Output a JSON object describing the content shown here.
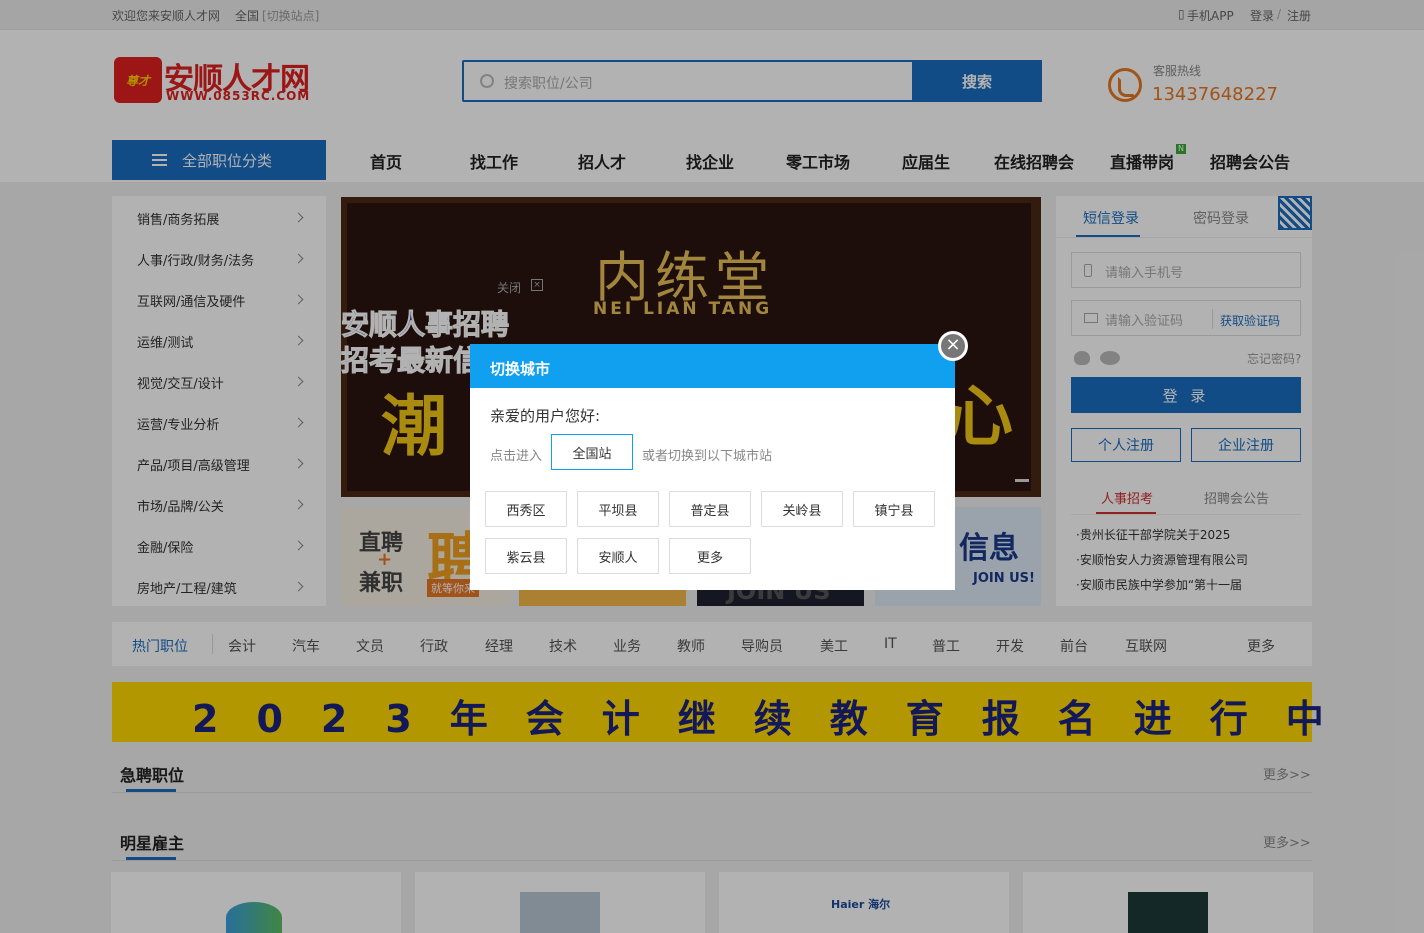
{
  "topbar": {
    "welcome": "欢迎您来安顺人才网",
    "region": "全国",
    "switch_site": "[切换站点]",
    "mobile_app": "手机APP",
    "login": "登录",
    "sep": "/",
    "register": "注册"
  },
  "header": {
    "logo_mark": "尊才",
    "logo_name": "安顺人才网",
    "logo_url": "WWW.0853RC.COM",
    "search_placeholder": "搜索职位/公司",
    "search_button": "搜索",
    "hotline_label": "客服热线",
    "hotline_number": "13437648227"
  },
  "nav": {
    "all_categories": "全部职位分类",
    "items": [
      "首页",
      "找工作",
      "招人才",
      "找企业",
      "零工市场",
      "应届生",
      "在线招聘会",
      "直播带岗",
      "招聘会公告"
    ],
    "badge": "N"
  },
  "sidebar": {
    "items": [
      "销售/商务拓展",
      "人事/行政/财务/法务",
      "互联网/通信及硬件",
      "运维/测试",
      "视觉/交互/设计",
      "运营/专业分析",
      "产品/项目/高级管理",
      "市场/品牌/公关",
      "金融/保险",
      "房地产/工程/建筑"
    ]
  },
  "banner": {
    "brand_cn": "内练堂",
    "brand_en": "NEI LIAN TANG",
    "close_label": "关闭",
    "overlay_line1": "安顺人事招聘",
    "overlay_line2": "招考最新信",
    "big_char_left": "潮",
    "big_char_right": "心"
  },
  "small_ads": {
    "ad1_line1": "直聘",
    "ad1_plus": "+",
    "ad1_line2": "兼职",
    "ad1_char": "聘",
    "ad1_sub": "就等你来",
    "ad4_title": "信息",
    "ad4_sub": "JOIN US!",
    "ad3_text": "JOIN US"
  },
  "login": {
    "tab_sms": "短信登录",
    "tab_password": "密码登录",
    "phone_placeholder": "请输入手机号",
    "code_placeholder": "请输入验证码",
    "get_code": "获取验证码",
    "forgot": "忘记密码?",
    "login_button": "登 录",
    "personal_register": "个人注册",
    "company_register": "企业注册",
    "news_tab1": "人事招考",
    "news_tab2": "招聘会公告",
    "news": [
      "·贵州长征干部学院关于2025",
      "·安顺怡安人力资源管理有限公司",
      "·安顺市民族中学参加“第十一届"
    ]
  },
  "hot_jobs": {
    "title": "热门职位",
    "items": [
      "会计",
      "汽车",
      "文员",
      "行政",
      "经理",
      "技术",
      "业务",
      "教师",
      "导购员",
      "美工",
      "IT",
      "普工",
      "开发",
      "前台",
      "互联网"
    ],
    "more": "更多"
  },
  "promo": {
    "text": "2023年会计继续教育报名进行中"
  },
  "sections": {
    "urgent": "急聘职位",
    "star": "明星雇主",
    "more": "更多>>"
  },
  "employers": {
    "haier": "Haier 海尔"
  },
  "modal": {
    "title": "切换城市",
    "greeting": "亲爱的用户您好:",
    "enter_label": "点击进入",
    "national_site": "全国站",
    "or_switch": "或者切换到以下城市站",
    "cities": [
      "西秀区",
      "平坝县",
      "普定县",
      "关岭县",
      "镇宁县",
      "紫云县",
      "安顺人",
      "更多"
    ],
    "close": "×"
  },
  "colors": {
    "primary": "#1a6dc0",
    "modal_header": "#11a0f0",
    "brand_red": "#e02020",
    "hotline": "#e87722"
  }
}
